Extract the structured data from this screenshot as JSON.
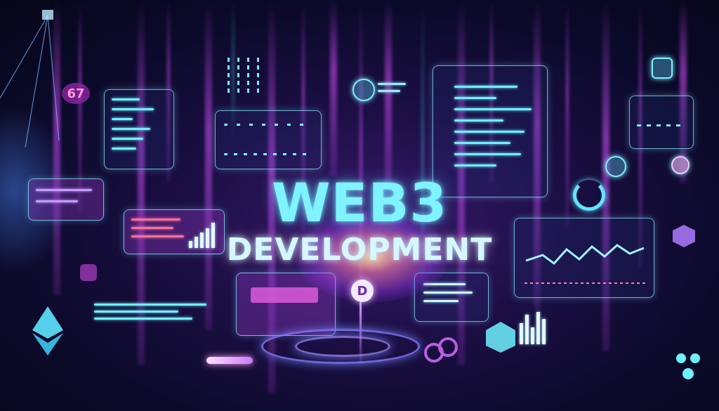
{
  "hero": {
    "title": "WEB3",
    "subtitle": "DEVELOPMENT"
  },
  "badges": {
    "center_coin_letter": "D",
    "left_badge_text": "67"
  },
  "colors": {
    "background": "#0b0a2a",
    "neon_cyan": "#7ff3ff",
    "neon_magenta": "#d650ff",
    "core_glow": "#ffdc96"
  },
  "icons": [
    "ethereum-icon",
    "coin-icon",
    "hexagon-icon",
    "cube-icon",
    "shield-icon",
    "chip-icon",
    "lock-icon",
    "chart-icon"
  ]
}
